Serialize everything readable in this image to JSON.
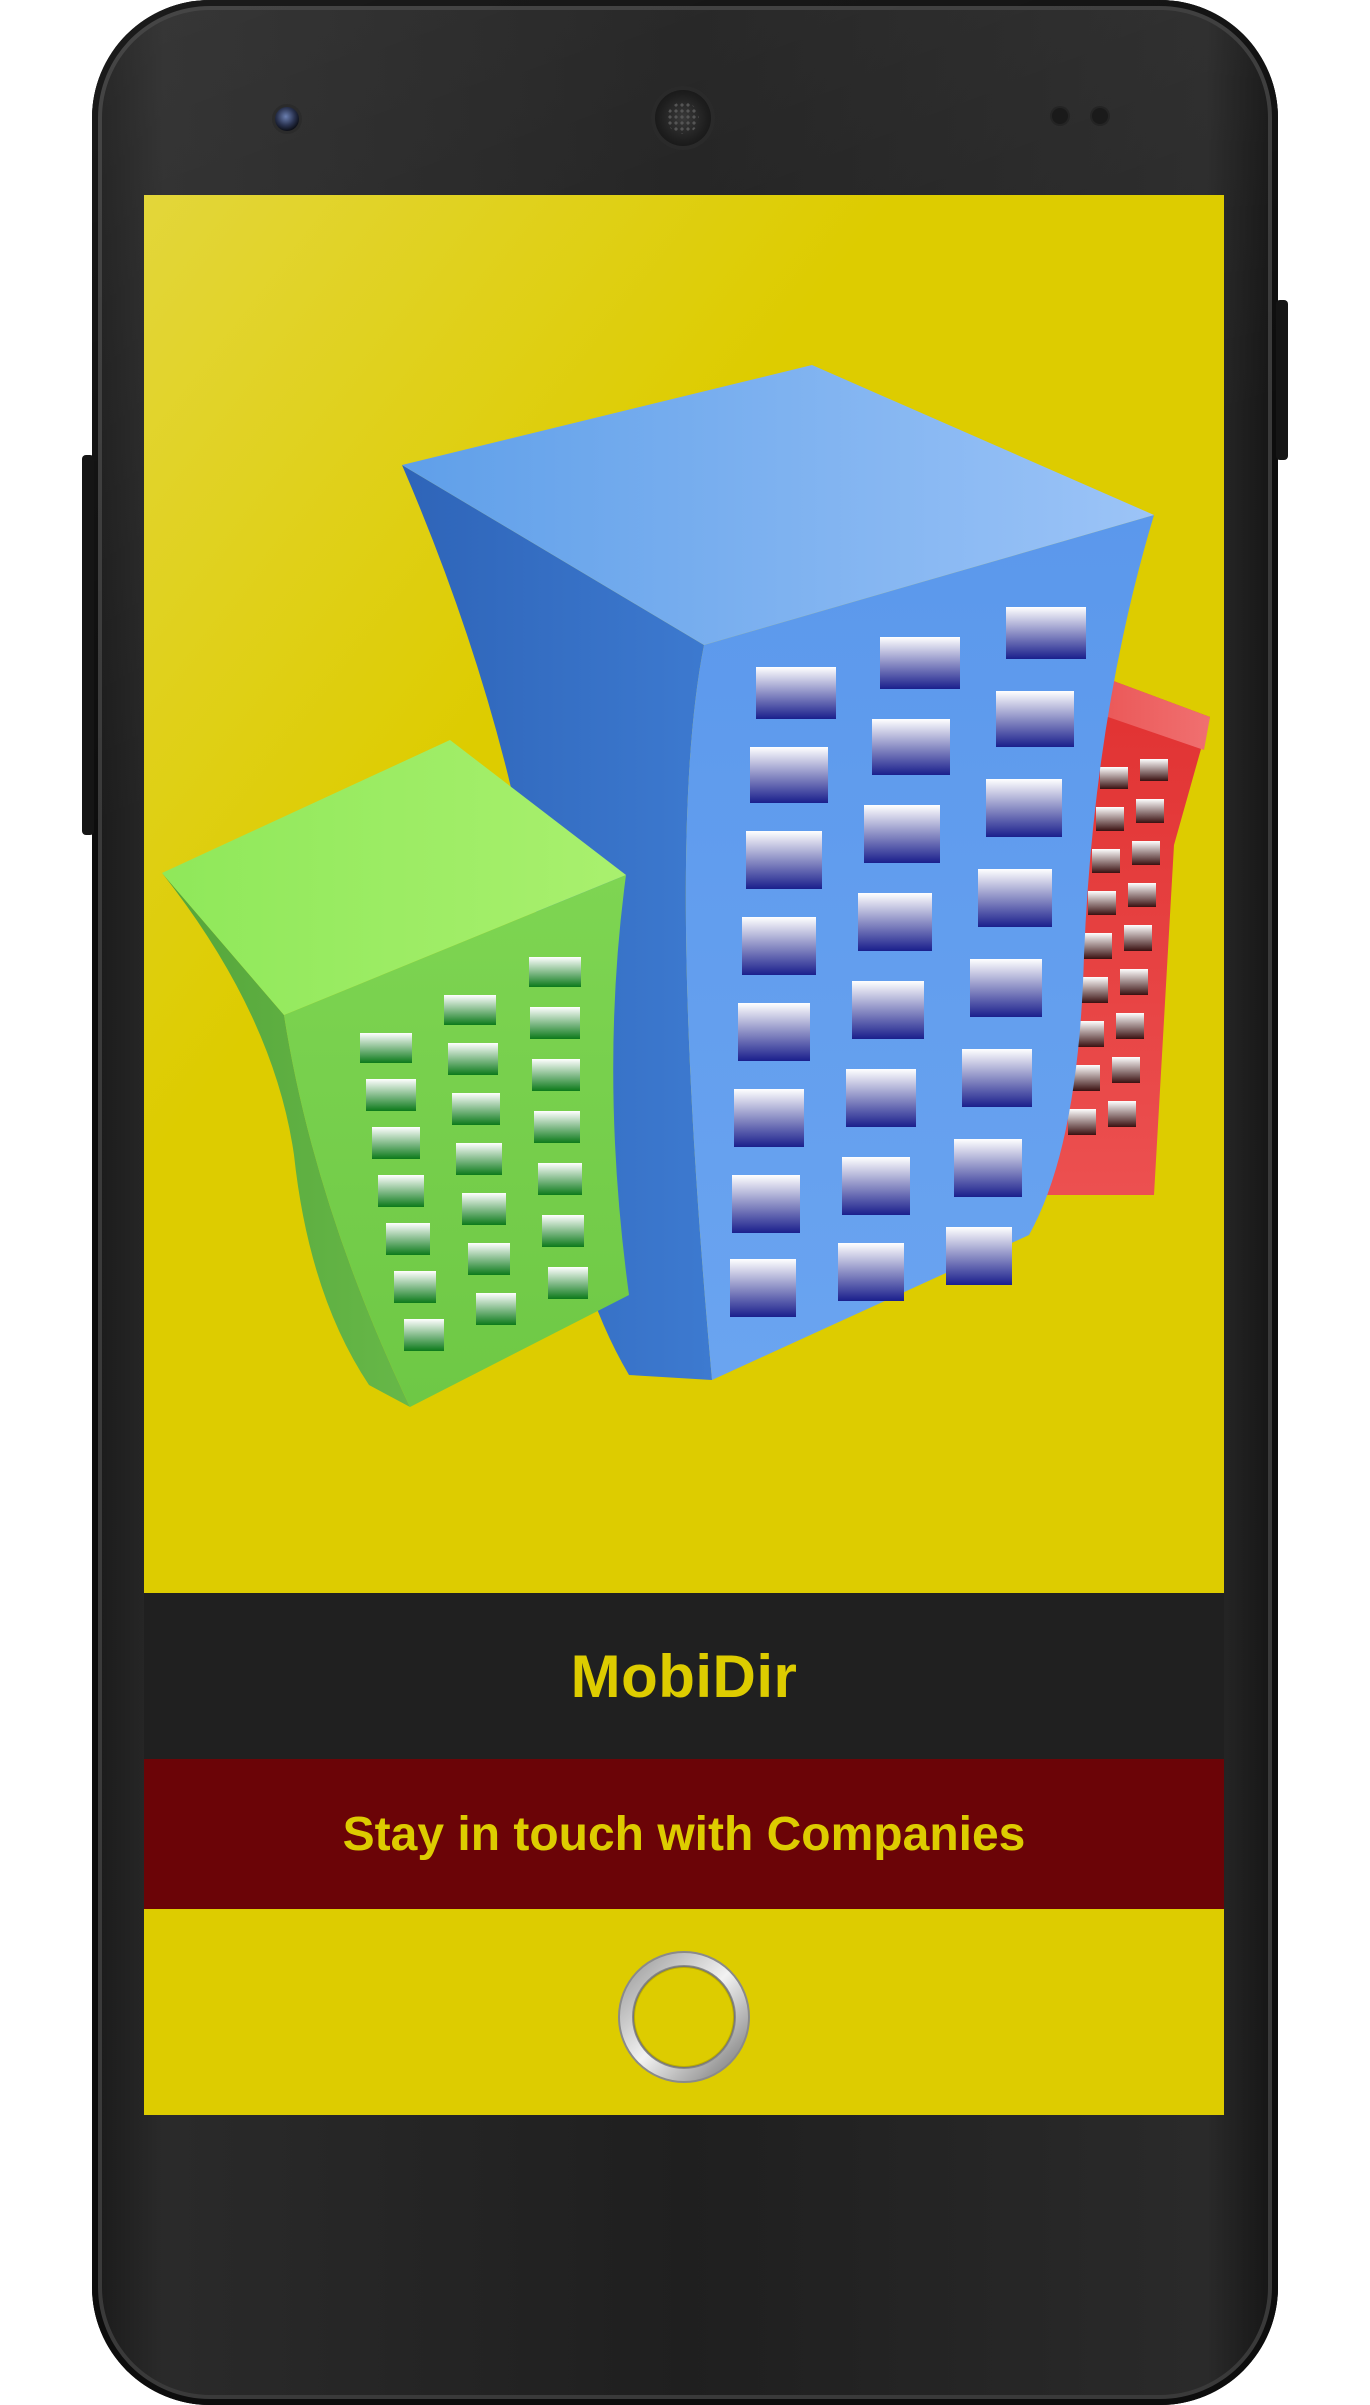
{
  "app": {
    "title": "MobiDir",
    "tagline": "Stay in touch with Companies"
  },
  "logo": {
    "icon": "office-buildings-icon"
  },
  "loading": {
    "icon": "loading-spinner-icon"
  },
  "colors": {
    "screen_background": "#ddcc00",
    "title_bar": "#202020",
    "tagline_bar": "#6b0407",
    "text_accent": "#ddcc00"
  }
}
